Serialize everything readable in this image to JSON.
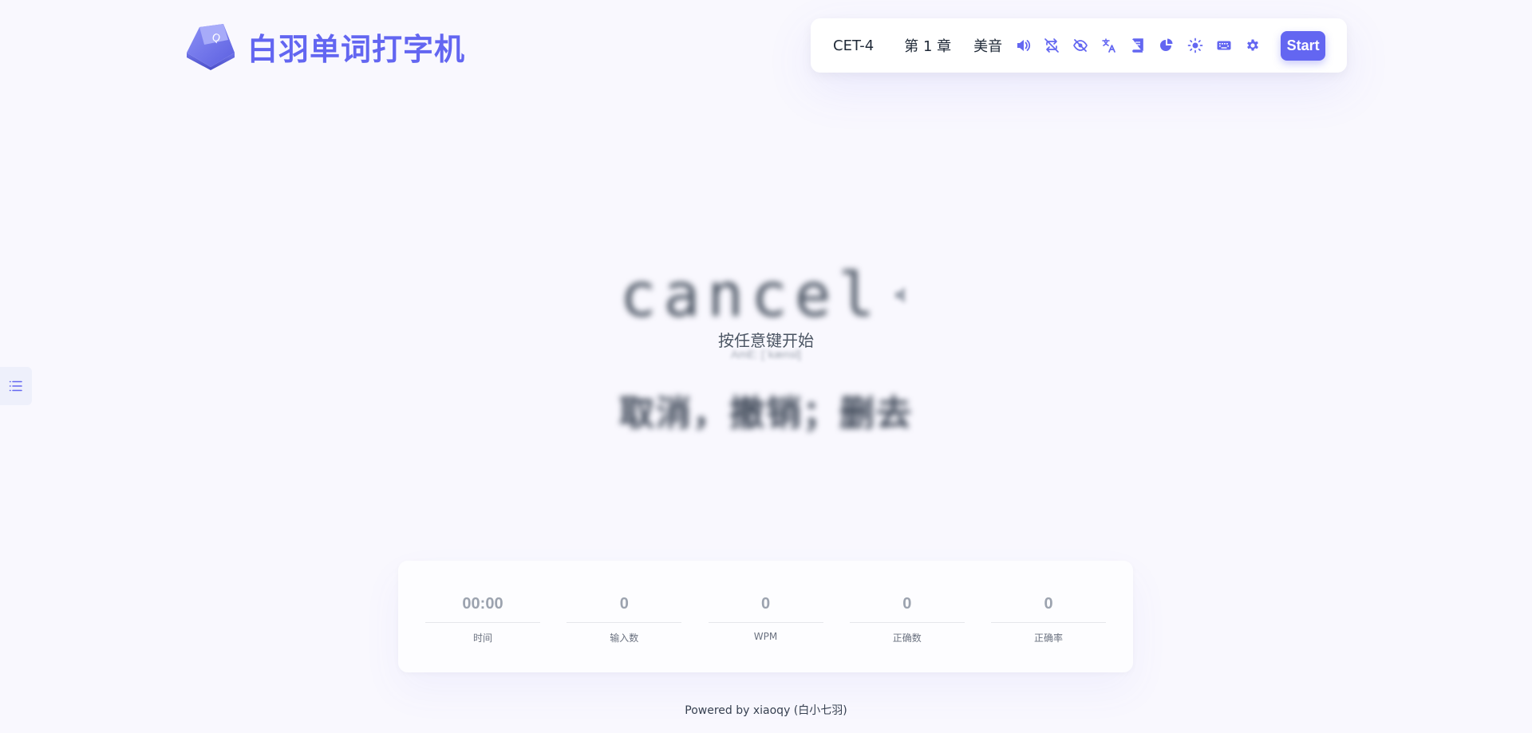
{
  "app": {
    "title": "白羽单词打字机",
    "logo_key_letter": "Q"
  },
  "toolbar": {
    "dictionary": "CET-4",
    "chapter": "第 1 章",
    "accent": "美音",
    "icons": [
      "volume-icon",
      "loop-off-icon",
      "eye-off-icon",
      "translate-icon",
      "book-icon",
      "pie-chart-icon",
      "sun-icon",
      "keyboard-icon",
      "gear-icon"
    ],
    "start_label": "Start"
  },
  "word": {
    "text": "cancel",
    "start_hint": "按任意键开始",
    "phonetic": "AmE: [ˈkænsl]",
    "translation": "取消，撤销；删去"
  },
  "stats": [
    {
      "value": "00:00",
      "label": "时间"
    },
    {
      "value": "0",
      "label": "输入数"
    },
    {
      "value": "0",
      "label": "WPM"
    },
    {
      "value": "0",
      "label": "正确数"
    },
    {
      "value": "0",
      "label": "正确率"
    }
  ],
  "footer": {
    "text": "Powered by xiaoqy (白小七羽)"
  },
  "colors": {
    "accent": "#6366f1",
    "background": "#f9f8fe"
  }
}
